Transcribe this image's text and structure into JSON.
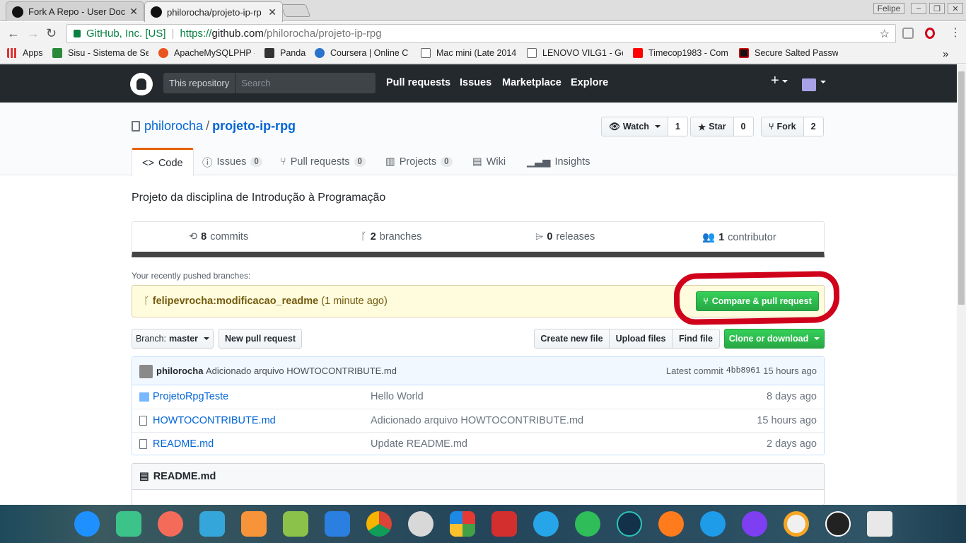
{
  "browser": {
    "tabs": [
      {
        "title": "Fork A Repo - User Docu"
      },
      {
        "title": "philorocha/projeto-ip-rp"
      }
    ],
    "user_badge": "Felipe",
    "address": {
      "org": "GitHub, Inc. [US]",
      "scheme": "https://",
      "host": "github.com",
      "path": "/philorocha/projeto-ip-rpg"
    },
    "bookmarks": [
      {
        "label": "Apps"
      },
      {
        "label": "Sisu - Sistema de Se"
      },
      {
        "label": "ApacheMySQLPHP -"
      },
      {
        "label": "Panda"
      },
      {
        "label": "Coursera | Online C"
      },
      {
        "label": "Mac mini (Late 2014"
      },
      {
        "label": "LENOVO VILG1 - Ge"
      },
      {
        "label": "Timecop1983 - Com"
      },
      {
        "label": "Secure Salted Passw"
      }
    ],
    "bookmarks_more": "»"
  },
  "github": {
    "scope_label": "This repository",
    "search_placeholder": "Search",
    "nav": [
      "Pull requests",
      "Issues",
      "Marketplace",
      "Explore"
    ],
    "plus": "+"
  },
  "repo": {
    "owner": "philorocha",
    "slash": "/",
    "name": "projeto-ip-rpg",
    "watch": {
      "label": "Watch",
      "count": "1"
    },
    "star": {
      "label": "Star",
      "count": "0"
    },
    "fork": {
      "label": "Fork",
      "count": "2"
    },
    "tabs": [
      {
        "label": "Code",
        "count": ""
      },
      {
        "label": "Issues",
        "count": "0"
      },
      {
        "label": "Pull requests",
        "count": "0"
      },
      {
        "label": "Projects",
        "count": "0"
      },
      {
        "label": "Wiki",
        "count": ""
      },
      {
        "label": "Insights",
        "count": ""
      }
    ],
    "description": "Projeto da disciplina de Introdução à Programação",
    "summary": {
      "commits": {
        "n": "8",
        "label": "commits"
      },
      "branches": {
        "n": "2",
        "label": "branches"
      },
      "releases": {
        "n": "0",
        "label": "releases"
      },
      "contributors": {
        "n": "1",
        "label": "contributor"
      }
    },
    "recent_label": "Your recently pushed branches:",
    "recent_branch": "felipevrocha:modificacao_readme",
    "recent_time": "(1 minute ago)",
    "compare_label": "Compare & pull request",
    "branch_label": "Branch:",
    "branch_value": "master",
    "new_pr": "New pull request",
    "create_file": "Create new file",
    "upload_files": "Upload files",
    "find_file": "Find file",
    "clone": "Clone or download",
    "commit": {
      "author": "philorocha",
      "message": "Adicionado arquivo HOWTOCONTRIBUTE.md",
      "latest_label": "Latest commit",
      "sha": "4bb8961",
      "age": "15 hours ago"
    },
    "files": [
      {
        "name": "ProjetoRpgTeste",
        "message": "Hello World",
        "age": "8 days ago"
      },
      {
        "name": "HOWTOCONTRIBUTE.md",
        "message": "Adicionado arquivo HOWTOCONTRIBUTE.md",
        "age": "15 hours ago"
      },
      {
        "name": "README.md",
        "message": "Update README.md",
        "age": "2 days ago"
      }
    ],
    "readme_title": "README.md"
  },
  "colors": {
    "header_bg": "#24292e",
    "link": "#0366d6",
    "green": "#28a745",
    "annotation": "#d0021b"
  },
  "dock_icons": [
    "launcher-icon",
    "files-icon",
    "presentation-icon",
    "usb-icon",
    "store-icon",
    "music-icon",
    "video-icon",
    "chrome-icon",
    "settings-icon",
    "gallery-icon",
    "terminal-icon",
    "remmina-icon",
    "whatsapp-icon",
    "camera-icon",
    "eject-icon",
    "wifi-icon",
    "power-icon",
    "ring-icon",
    "clock-icon",
    "trash-icon"
  ]
}
